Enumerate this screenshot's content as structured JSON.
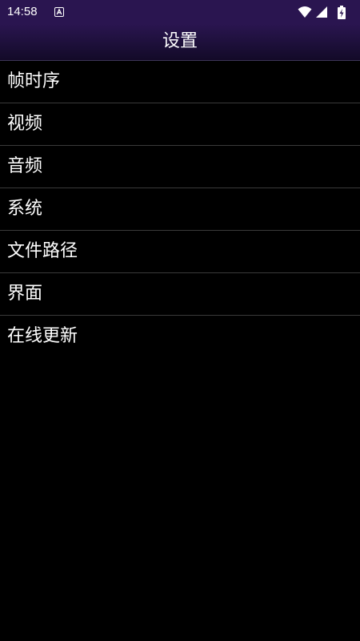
{
  "status_bar": {
    "time": "14:58",
    "notification_icon": "a-box-icon",
    "icons": [
      "wifi-icon",
      "signal-icon",
      "battery-charging-icon"
    ]
  },
  "app_bar": {
    "title": "设置"
  },
  "menu": {
    "items": [
      {
        "label": "帧时序"
      },
      {
        "label": "视频"
      },
      {
        "label": "音频"
      },
      {
        "label": "系统"
      },
      {
        "label": "文件路径"
      },
      {
        "label": "界面"
      },
      {
        "label": "在线更新"
      }
    ]
  },
  "colors": {
    "app_bar_bg": "#2a1550",
    "background": "#000000",
    "divider": "#3a3a3a",
    "text": "#ffffff"
  }
}
